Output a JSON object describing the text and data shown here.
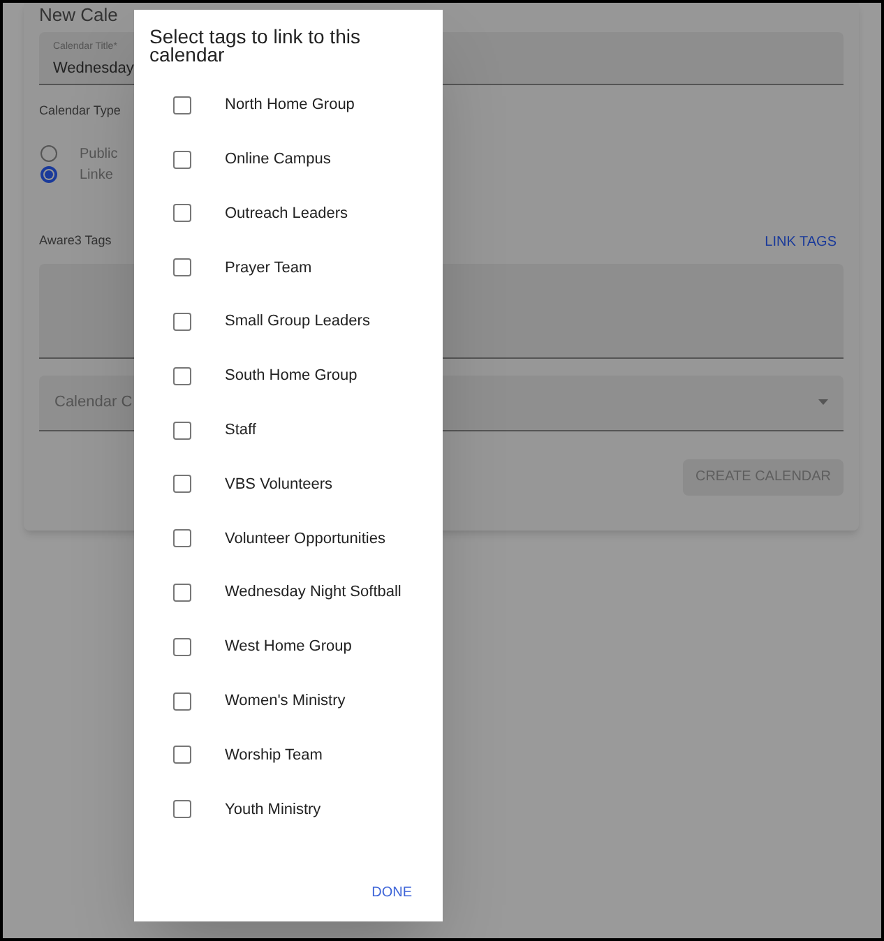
{
  "page": {
    "title": "New Cale",
    "title_field": {
      "label": "Calendar Title*",
      "value": "Wednesday"
    },
    "calendar_type": {
      "label": "Calendar Type",
      "options": [
        {
          "label": "Public",
          "selected": false
        },
        {
          "label": "Linke",
          "selected": true
        }
      ]
    },
    "tags": {
      "label": "Aware3 Tags",
      "link_button": "LINK TAGS"
    },
    "color_field": {
      "placeholder": "Calendar C"
    },
    "create_button": {
      "label": "CREATE CALENDAR",
      "disabled": true
    }
  },
  "dialog": {
    "title": "Select tags to link to this calendar",
    "tags": [
      {
        "label": "North Home Group",
        "checked": false
      },
      {
        "label": "Online Campus",
        "checked": false
      },
      {
        "label": "Outreach Leaders",
        "checked": false
      },
      {
        "label": "Prayer Team",
        "checked": false
      },
      {
        "label": "Small Group Leaders",
        "checked": false
      },
      {
        "label": "South Home Group",
        "checked": false
      },
      {
        "label": "Staff",
        "checked": false
      },
      {
        "label": "VBS Volunteers",
        "checked": false
      },
      {
        "label": "Volunteer Opportunities",
        "checked": false
      },
      {
        "label": "Wednesday Night Softball",
        "checked": false
      },
      {
        "label": "West Home Group",
        "checked": false
      },
      {
        "label": "Women's Ministry",
        "checked": false
      },
      {
        "label": "Worship Team",
        "checked": false
      },
      {
        "label": "Youth Ministry",
        "checked": false
      }
    ],
    "done_button": "DONE"
  }
}
